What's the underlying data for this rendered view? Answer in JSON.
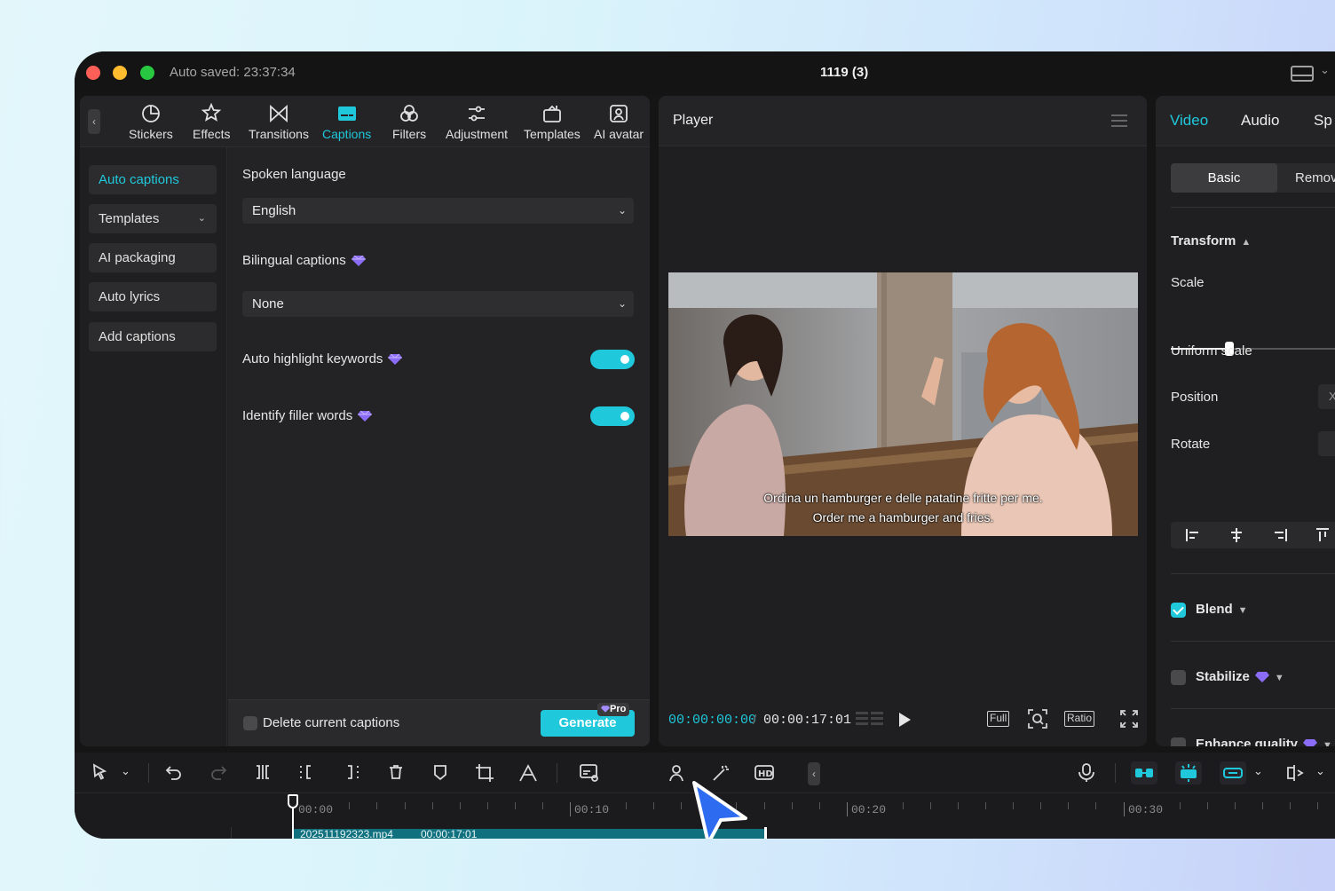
{
  "window": {
    "autosave": "Auto saved: 23:37:34",
    "title": "1119 (3)"
  },
  "toolbar": {
    "items": [
      {
        "label": "Stickers",
        "icon": "stickers-icon"
      },
      {
        "label": "Effects",
        "icon": "effects-icon"
      },
      {
        "label": "Transitions",
        "icon": "transitions-icon"
      },
      {
        "label": "Captions",
        "icon": "captions-icon",
        "active": true
      },
      {
        "label": "Filters",
        "icon": "filters-icon"
      },
      {
        "label": "Adjustment",
        "icon": "adjustment-icon"
      },
      {
        "label": "Templates",
        "icon": "templates-icon"
      },
      {
        "label": "AI avatar",
        "icon": "ai-avatar-icon"
      }
    ]
  },
  "sidenav": {
    "items": [
      {
        "label": "Auto captions",
        "active": true
      },
      {
        "label": "Templates"
      },
      {
        "label": "AI packaging"
      },
      {
        "label": "Auto lyrics"
      },
      {
        "label": "Add captions"
      }
    ]
  },
  "captions": {
    "spoken_language_label": "Spoken language",
    "spoken_language_value": "English",
    "bilingual_label": "Bilingual captions",
    "bilingual_value": "None",
    "highlight_label": "Auto highlight keywords",
    "highlight_on": true,
    "filler_label": "Identify filler words",
    "filler_on": true,
    "delete_label": "Delete current captions",
    "generate_label": "Generate",
    "pro_badge": "Pro"
  },
  "player": {
    "title": "Player",
    "subtitle_line1": "Ordina un hamburger e delle patatine fritte per me.",
    "subtitle_line2": "Order me a hamburger and fries.",
    "timecode_current": "00:00:00:00",
    "timecode_separator": "/",
    "timecode_total": "00:00:17:01",
    "full_label": "Full",
    "ratio_label": "Ratio"
  },
  "inspector": {
    "tabs": [
      {
        "label": "Video",
        "active": true
      },
      {
        "label": "Audio"
      },
      {
        "label": "Sp"
      }
    ],
    "seg_basic": "Basic",
    "seg_remove": "Remov",
    "transform_label": "Transform",
    "scale_label": "Scale",
    "scale_fraction": 0.3,
    "uniform_scale_label": "Uniform scale",
    "position_label": "Position",
    "position_field": "X",
    "rotate_label": "Rotate",
    "blend_label": "Blend",
    "blend_checked": true,
    "stabilize_label": "Stabilize",
    "enhance_label": "Enhance quality"
  },
  "timeline": {
    "ruler": [
      "00:00",
      "00:10",
      "00:20",
      "00:30"
    ],
    "clip_name": "202511192323.mp4",
    "clip_duration": "00:00:17:01"
  },
  "colors": {
    "accent": "#1fc8db",
    "pro_gem": "#8b6cf6"
  }
}
